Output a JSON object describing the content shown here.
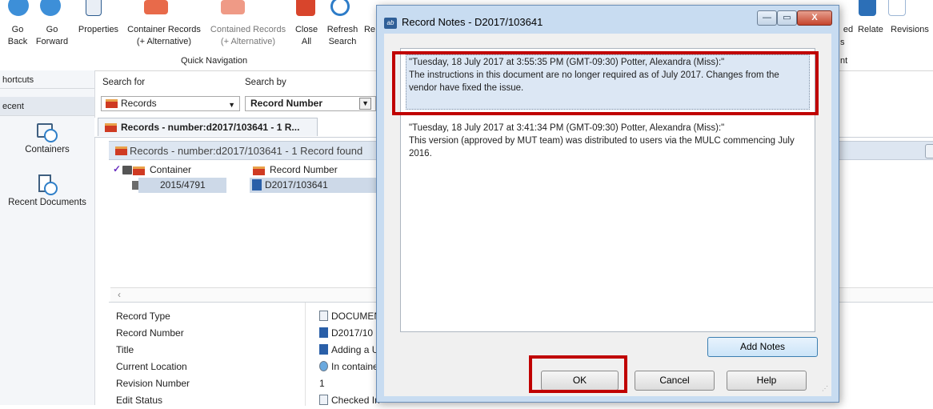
{
  "ribbon": {
    "buttons": [
      {
        "label": "Go\nBack",
        "name": "go-back-button",
        "icon": "left-arrow-icon"
      },
      {
        "label": "Go\nForward",
        "name": "go-forward-button",
        "icon": "right-arrow-icon"
      },
      {
        "label": "Properties",
        "name": "properties-button",
        "icon": "properties-icon"
      },
      {
        "label": "Container Records\n(+ Alternative)",
        "name": "container-records-button",
        "icon": "container-globe-icon"
      },
      {
        "label": "Contained Records\n(+ Alternative)",
        "name": "contained-records-button",
        "icon": "contained-globe-icon"
      },
      {
        "label": "Close\nAll",
        "name": "close-all-button",
        "icon": "close-x-icon"
      },
      {
        "label": "Refresh\nSearch",
        "name": "refresh-search-button",
        "icon": "refresh-icon"
      },
      {
        "label": "Re",
        "name": "re-button",
        "icon": "re-icon"
      }
    ],
    "right_buttons": [
      {
        "label": "ed",
        "name": "ed-button"
      },
      {
        "label": "Relate",
        "name": "relate-button"
      },
      {
        "label": "Revisions",
        "name": "revisions-button"
      }
    ],
    "right_sub_labels": [
      "s",
      "nt"
    ],
    "group_label": "Quick Navigation"
  },
  "leftnav": {
    "shortcuts_label": "hortcuts",
    "recent_label": "ecent",
    "containers_label": "Containers",
    "recent_documents_label": "Recent Documents"
  },
  "search": {
    "search_for_label": "Search for",
    "search_by_label": "Search by",
    "search_for_value": "Records",
    "search_by_value": "Record Number"
  },
  "results": {
    "tab_label": "Records - number:d2017/103641 - 1 R...",
    "header": "Records - number:d2017/103641 - 1 Record found",
    "columns": [
      "Container",
      "Record Number"
    ],
    "row": {
      "container": "2015/4791",
      "record_number": "D2017/103641"
    },
    "scroll_arrow": "‹"
  },
  "properties": [
    {
      "label": "Record Type",
      "value": "DOCUMEN"
    },
    {
      "label": "Record Number",
      "value": "D2017/10"
    },
    {
      "label": "Title",
      "value": "Adding a U"
    },
    {
      "label": "Current Location",
      "value": "In containe"
    },
    {
      "label": "Revision Number",
      "value": "1"
    },
    {
      "label": "Edit Status",
      "value": "Checked In"
    }
  ],
  "dialog": {
    "title": "Record Notes - D2017/103641",
    "app_icon_text": "ab",
    "window_buttons": {
      "minimize": "—",
      "maximize": "▭",
      "close": "X"
    },
    "notes": [
      {
        "header": "\"Tuesday, 18 July 2017 at 3:55:35 PM (GMT-09:30)   Potter, Alexandra (Miss):\"",
        "body": "The instructions in this document are no longer required as of July 2017. Changes from the vendor have fixed the issue."
      },
      {
        "header": "\"Tuesday, 18 July 2017 at 3:41:34 PM (GMT-09:30)   Potter, Alexandra (Miss):\"",
        "body": "This version (approved by MUT team) was distributed to users via the MULC commencing July 2016."
      }
    ],
    "add_notes_label": "Add Notes",
    "ok_label": "OK",
    "cancel_label": "Cancel",
    "help_label": "Help"
  },
  "colors": {
    "highlight": "#c00000",
    "folder_red": "#cf3a22",
    "dialog_frame": "#c8dcf1",
    "selection": "#cdd9e8"
  }
}
